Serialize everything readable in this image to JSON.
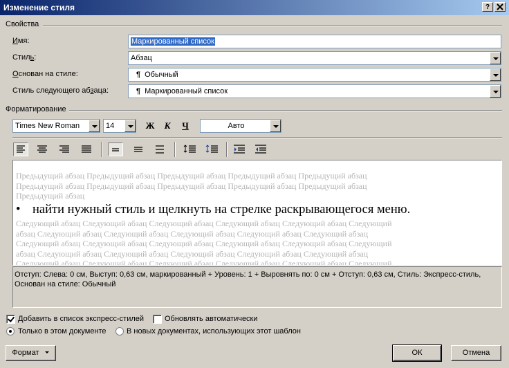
{
  "window": {
    "title": "Изменение стиля",
    "help_button": "?",
    "close_button": "X"
  },
  "properties": {
    "section_label": "Свойства",
    "name_label": "Имя:",
    "name_value": "Маркированный список",
    "type_label": "Стиль:",
    "type_value": "Абзац",
    "based_on_label": "Основан на стиле:",
    "based_on_value": "Обычный",
    "next_style_label": "Стиль следующего абзаца:",
    "next_style_value": "Маркированный список",
    "pilcrow": "¶"
  },
  "formatting": {
    "section_label": "Форматирование",
    "font": "Times New Roman",
    "size": "14",
    "bold": "Ж",
    "italic": "К",
    "underline": "Ч",
    "color": "Авто"
  },
  "preview": {
    "prev_lines": [
      "Предыдущий абзац Предыдущий абзац Предыдущий абзац Предыдущий абзац Предыдущий абзац",
      "Предыдущий абзац Предыдущий абзац Предыдущий абзац Предыдущий абзац Предыдущий абзац",
      "Предыдущий абзац"
    ],
    "bullet": "•",
    "current": "найти нужный стиль и щелкнуть на стрелке раскрывающегося меню.",
    "next_lines": [
      "Следующий абзац Следующий абзац Следующий абзац Следующий абзац Следующий абзац Следующий",
      "абзац Следующий абзац Следующий абзац Следующий абзац Следующий абзац Следующий абзац",
      "Следующий абзац Следующий абзац Следующий абзац Следующий абзац Следующий абзац Следующий",
      "абзац Следующий абзац Следующий абзац Следующий абзац Следующий абзац Следующий абзац",
      "Следующий абзац Следующий абзац Следующий абзац Следующий абзац Следующий абзац Следующий"
    ]
  },
  "description": "Отступ: Слева:  0 см, Выступ:  0,63 см, маркированный + Уровень: 1 + Выровнять по:  0 см + Отступ:  0,63 см, Стиль: Экспресс-стиль, Основан на стиле: Обычный",
  "options": {
    "add_quick_styles_label": "Добавить в список экспресс-стилей",
    "add_quick_styles_checked": true,
    "auto_update_label": "Обновлять автоматически",
    "auto_update_checked": false,
    "only_this_doc_label": "Только в этом документе",
    "new_docs_label": "В новых документах, использующих этот шаблон",
    "selected_scope": "only_this_doc"
  },
  "buttons": {
    "format": "Формат",
    "ok": "ОК",
    "cancel": "Отмена"
  }
}
